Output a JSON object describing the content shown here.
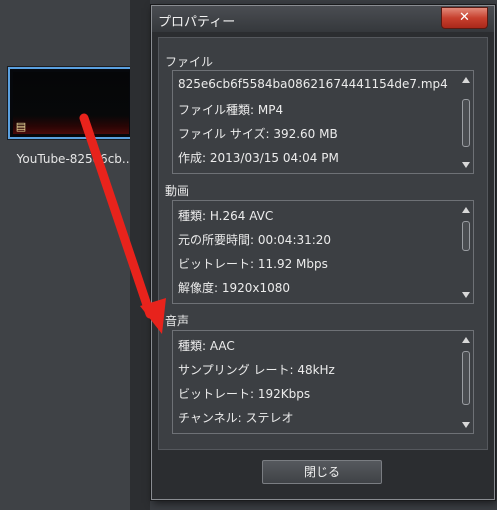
{
  "library": {
    "thumbnail_label": "YouTube-825e6cb..."
  },
  "dialog": {
    "title": "プロパティー",
    "close_glyph": "✕",
    "file": {
      "heading": "ファイル",
      "lines": [
        "825e6cb6f5584ba08621674441154de7.mp4",
        "ファイル種類: MP4",
        "ファイル サイズ: 392.60 MB",
        "作成: 2013/03/15 04:04 PM"
      ]
    },
    "video": {
      "heading": "動画",
      "lines": [
        "種類: H.264 AVC",
        "元の所要時間: 00:04:31:20",
        "ビットレート: 11.92 Mbps",
        "解像度: 1920x1080"
      ]
    },
    "audio": {
      "heading": "音声",
      "lines": [
        "種類: AAC",
        "サンプリング レート: 48kHz",
        "ビットレート: 192Kbps",
        "チャンネル: ステレオ"
      ]
    },
    "close_button_label": "閉じる"
  },
  "colors": {
    "annotation_arrow": "#e8231c",
    "thumbnail_selection": "#5aa0e0"
  }
}
